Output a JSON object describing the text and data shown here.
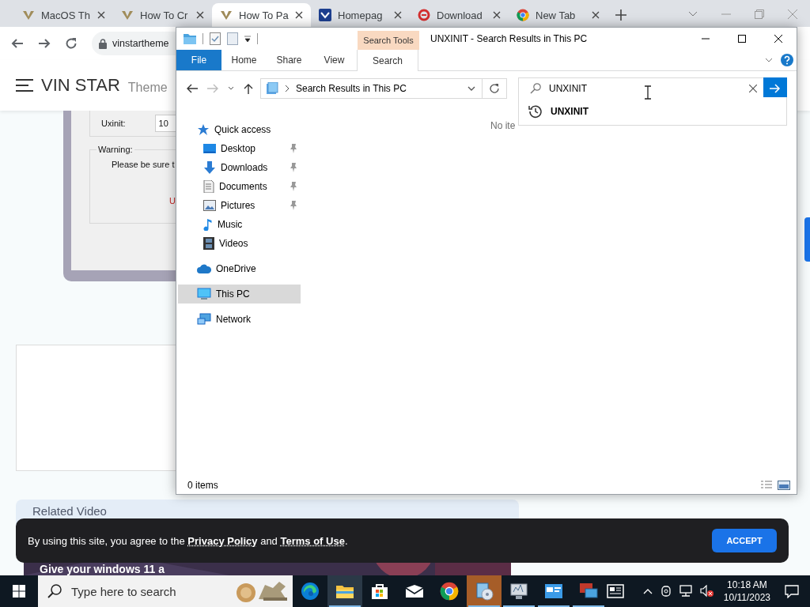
{
  "browser": {
    "tabs": [
      {
        "title": "MacOS Th",
        "kind": "v-logo",
        "selected": false
      },
      {
        "title": "How To Cr",
        "kind": "v-logo",
        "selected": false
      },
      {
        "title": "How To Pa",
        "kind": "v-logo",
        "selected": true
      },
      {
        "title": "Homepag",
        "kind": "square-logo",
        "selected": false
      },
      {
        "title": "Download",
        "kind": "ring-logo",
        "selected": false
      },
      {
        "title": "New Tab",
        "kind": "browser-logo",
        "selected": false
      }
    ],
    "url": "vinstartheme"
  },
  "site": {
    "logo": "VIN STAR",
    "logo_suffix": "Theme",
    "dialog": {
      "field_label": "Uxinit:",
      "field_value": "10",
      "group_label": "Warning:",
      "message": "Please be sure t",
      "button_fragment": "U"
    },
    "related_title": "Related Video",
    "video_title": "Give your windows 11 a"
  },
  "explorer": {
    "title": "UNXINIT - Search Results in This PC",
    "context_tab": "Search Tools",
    "ribbon_tabs": [
      {
        "label": "File",
        "kind": "file",
        "selected": false
      },
      {
        "label": "Home",
        "kind": "tab",
        "selected": false
      },
      {
        "label": "Share",
        "kind": "tab",
        "selected": false
      },
      {
        "label": "View",
        "kind": "tab",
        "selected": false
      },
      {
        "label": "Search",
        "kind": "tab",
        "selected": true
      }
    ],
    "address": "Search Results in This PC",
    "search": {
      "value": "UNXINIT",
      "suggestions": [
        "UNXINIT"
      ]
    },
    "nav": [
      {
        "label": "Quick access",
        "kind": "star",
        "selected": false,
        "children": [
          {
            "label": "Desktop",
            "kind": "desktop",
            "pinned": true,
            "selected": false
          },
          {
            "label": "Downloads",
            "kind": "downloads",
            "pinned": true,
            "selected": false
          },
          {
            "label": "Documents",
            "kind": "documents",
            "pinned": true,
            "selected": false
          },
          {
            "label": "Pictures",
            "kind": "pictures",
            "pinned": true,
            "selected": false
          },
          {
            "label": "Music",
            "kind": "music",
            "pinned": false,
            "selected": false
          },
          {
            "label": "Videos",
            "kind": "videos",
            "pinned": false,
            "selected": false
          }
        ]
      },
      {
        "label": "OneDrive",
        "kind": "cloud",
        "selected": false
      },
      {
        "label": "This PC",
        "kind": "pc",
        "selected": true
      },
      {
        "label": "Network",
        "kind": "network",
        "selected": false
      }
    ],
    "empty_message": "No ite",
    "status": "0 items"
  },
  "cookie": {
    "lead": "By using this site, you agree to the",
    "links": [
      "Privacy Policy",
      "Terms of Use"
    ],
    "joiner": "and",
    "end": ".",
    "button": "ACCEPT"
  },
  "taskbar": {
    "search_placeholder": "Type here to search",
    "apps": [
      {
        "kind": "edge",
        "running": false,
        "active": false,
        "flashing": false
      },
      {
        "kind": "folder",
        "running": true,
        "active": true,
        "flashing": false
      },
      {
        "kind": "store",
        "running": false,
        "active": false,
        "flashing": false
      },
      {
        "kind": "mail",
        "running": false,
        "active": false,
        "flashing": false
      },
      {
        "kind": "chrome",
        "running": false,
        "active": false,
        "flashing": false
      },
      {
        "kind": "installer",
        "running": true,
        "active": false,
        "flashing": true
      },
      {
        "kind": "monitor",
        "running": true,
        "active": false,
        "flashing": false
      },
      {
        "kind": "control-panel",
        "running": true,
        "active": false,
        "flashing": false
      },
      {
        "kind": "remote-desktop",
        "running": true,
        "active": false,
        "flashing": false
      }
    ],
    "time": "10:18 AM",
    "date": "10/11/2023"
  }
}
